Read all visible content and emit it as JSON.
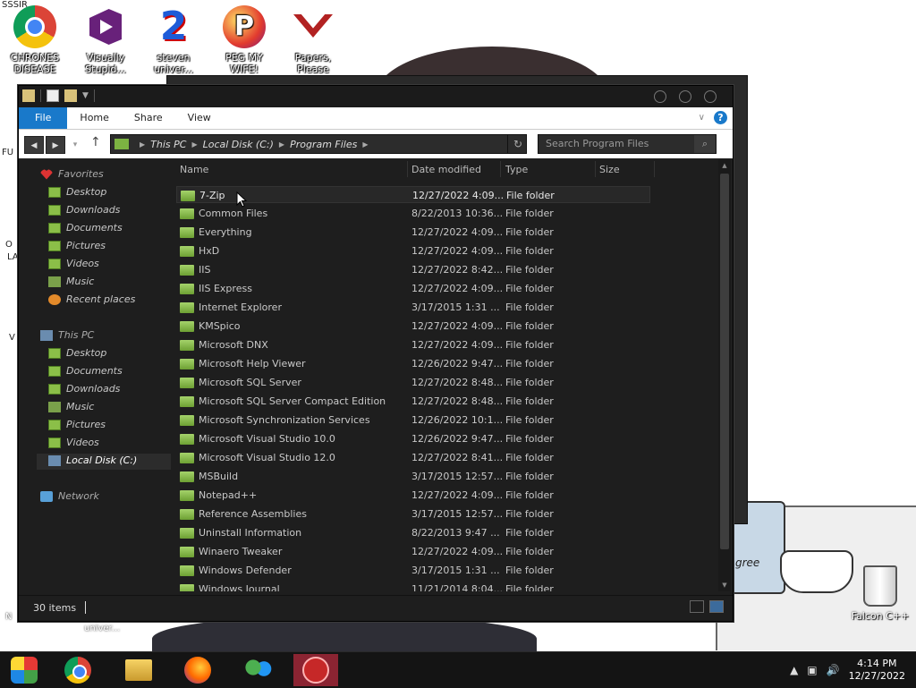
{
  "desktop": {
    "corner_text": "SSSIR",
    "icons": [
      {
        "label": "CHRONES DISEASE",
        "icon": "chrome-icon"
      },
      {
        "label": "Visually Stupid...",
        "icon": "visual-studio-icon"
      },
      {
        "label": "steven univer...",
        "icon": "steven-universe-icon"
      },
      {
        "label": "PEG MY WIFE!",
        "icon": "peggle-icon"
      },
      {
        "label": "Papers, Please",
        "icon": "papers-please-icon"
      }
    ],
    "recycle_label": "Falcon C++",
    "jar_text": "gree",
    "strip": [
      "FU",
      "O",
      "LA",
      "V",
      "N",
      "univer..."
    ]
  },
  "window": {
    "ribbon": {
      "tabs": [
        "File",
        "Home",
        "Share",
        "View"
      ]
    },
    "address": {
      "parts": [
        "This PC",
        "Local Disk (C:)",
        "Program Files"
      ]
    },
    "search_placeholder": "Search Program Files",
    "nav": {
      "favorites": "Favorites",
      "favorite_items": [
        "Desktop",
        "Downloads",
        "Documents",
        "Pictures",
        "Videos",
        "Music",
        "Recent places"
      ],
      "this_pc": "This PC",
      "pc_items": [
        "Desktop",
        "Documents",
        "Downloads",
        "Music",
        "Pictures",
        "Videos",
        "Local Disk (C:)"
      ],
      "network": "Network"
    },
    "columns": [
      "Name",
      "Date modified",
      "Type",
      "Size"
    ],
    "files": [
      {
        "name": "7-Zip",
        "date": "12/27/2022 4:09...",
        "type": "File folder"
      },
      {
        "name": "Common Files",
        "date": "8/22/2013 10:36...",
        "type": "File folder"
      },
      {
        "name": "Everything",
        "date": "12/27/2022 4:09...",
        "type": "File folder"
      },
      {
        "name": "HxD",
        "date": "12/27/2022 4:09...",
        "type": "File folder"
      },
      {
        "name": "IIS",
        "date": "12/27/2022 8:42...",
        "type": "File folder"
      },
      {
        "name": "IIS Express",
        "date": "12/27/2022 4:09...",
        "type": "File folder"
      },
      {
        "name": "Internet Explorer",
        "date": "3/17/2015 1:31 ...",
        "type": "File folder"
      },
      {
        "name": "KMSpico",
        "date": "12/27/2022 4:09...",
        "type": "File folder"
      },
      {
        "name": "Microsoft DNX",
        "date": "12/27/2022 4:09...",
        "type": "File folder"
      },
      {
        "name": "Microsoft Help Viewer",
        "date": "12/26/2022 9:47...",
        "type": "File folder"
      },
      {
        "name": "Microsoft SQL Server",
        "date": "12/27/2022 8:48...",
        "type": "File folder"
      },
      {
        "name": "Microsoft SQL Server Compact Edition",
        "date": "12/27/2022 8:48...",
        "type": "File folder"
      },
      {
        "name": "Microsoft Synchronization Services",
        "date": "12/26/2022 10:1...",
        "type": "File folder"
      },
      {
        "name": "Microsoft Visual Studio 10.0",
        "date": "12/26/2022 9:47...",
        "type": "File folder"
      },
      {
        "name": "Microsoft Visual Studio 12.0",
        "date": "12/27/2022 8:41...",
        "type": "File folder"
      },
      {
        "name": "MSBuild",
        "date": "3/17/2015 12:57...",
        "type": "File folder"
      },
      {
        "name": "Notepad++",
        "date": "12/27/2022 4:09...",
        "type": "File folder"
      },
      {
        "name": "Reference Assemblies",
        "date": "3/17/2015 12:57...",
        "type": "File folder"
      },
      {
        "name": "Uninstall Information",
        "date": "8/22/2013 9:47 ...",
        "type": "File folder"
      },
      {
        "name": "Winaero Tweaker",
        "date": "12/27/2022 4:09...",
        "type": "File folder"
      },
      {
        "name": "Windows Defender",
        "date": "3/17/2015 1:31 ...",
        "type": "File folder"
      },
      {
        "name": "Windows Journal",
        "date": "11/21/2014 8:04...",
        "type": "File folder"
      }
    ],
    "status": "30 items"
  },
  "taskbar": {
    "apps": [
      "start-icon",
      "chrome-icon",
      "file-explorer-icon",
      "firefox-icon",
      "people-icon",
      "radiation-icon"
    ],
    "time": "4:14 PM",
    "date": "12/27/2022"
  },
  "colors": {
    "accent": "#1979ca",
    "window_bg": "#1e1e1e",
    "folder": "#8bbf48",
    "taskbar_active": "#8b2432"
  }
}
